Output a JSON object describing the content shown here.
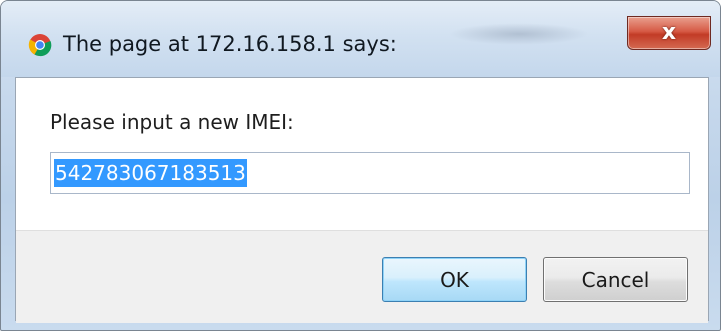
{
  "dialog": {
    "title": "The page at 172.16.158.1 says:",
    "close_glyph": "x",
    "prompt_label": "Please input a new IMEI:",
    "input_value": "542783067183513",
    "ok_label": "OK",
    "cancel_label": "Cancel"
  },
  "icons": {
    "app": "chrome-icon",
    "close": "close-icon"
  },
  "colors": {
    "selection": "#3399ff",
    "close_button": "#c23b26",
    "ok_border": "#3c7fb1"
  }
}
